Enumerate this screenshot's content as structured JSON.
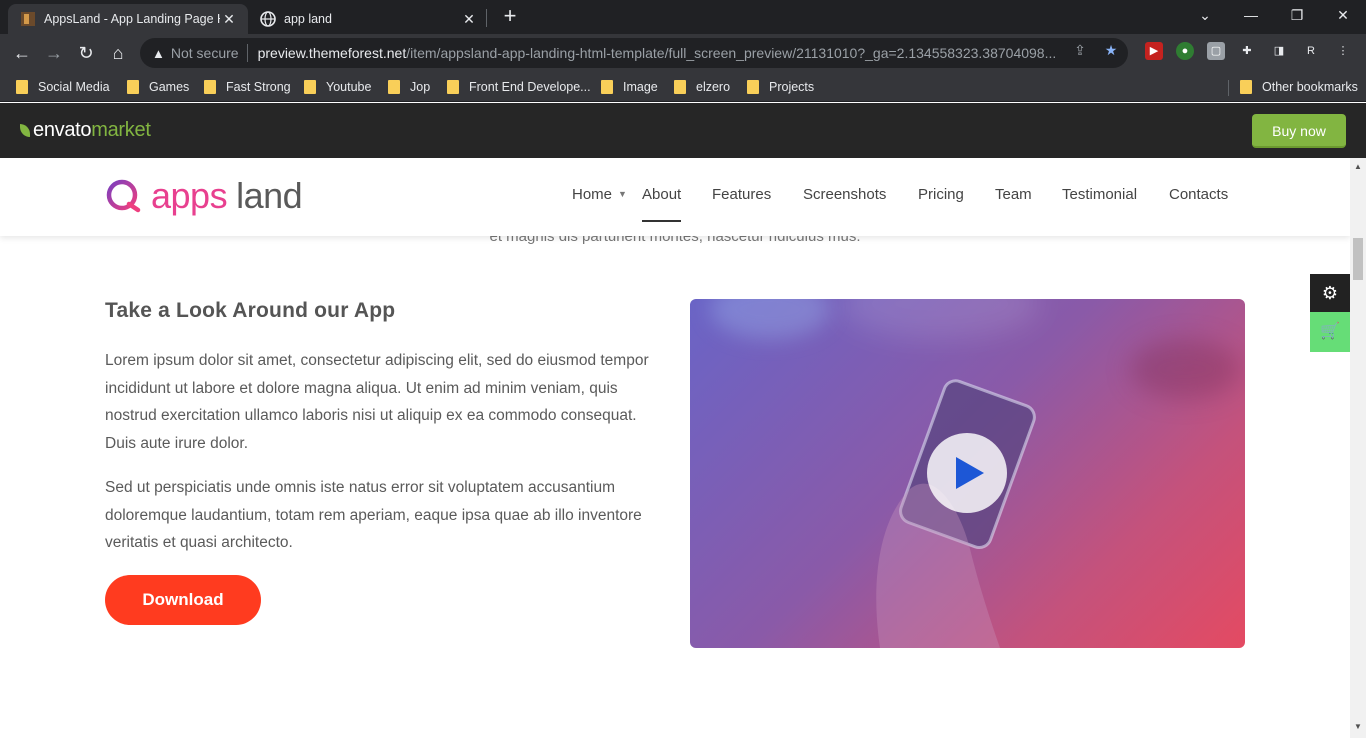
{
  "browser": {
    "tabs": [
      {
        "title": "AppsLand - App Landing Page HTML",
        "active": true
      },
      {
        "title": "app land",
        "active": false
      }
    ],
    "close_glyph": "✕",
    "new_tab_glyph": "+",
    "window_controls": {
      "dropdown": "⌄",
      "minimize": "—",
      "restore": "❐",
      "close": "✕"
    },
    "toolbar": {
      "back": "←",
      "forward": "→",
      "reload": "↻",
      "home": "⌂",
      "security_label": "Not secure",
      "url_host": "preview.themeforest.net",
      "url_path": "/item/appsland-app-landing-html-template/full_screen_preview/21131010?_ga=2.134558323.38704098...",
      "profile_initial": "R"
    },
    "bookmarks": [
      "Social Media",
      "Games",
      "Fast Strong",
      "Youtube",
      "Jop",
      "Front End Develope...",
      "Image",
      "elzero",
      "Projects"
    ],
    "other_bookmarks": "Other bookmarks"
  },
  "envato": {
    "logo_envato": "envato",
    "logo_market": "market",
    "buy_now": "Buy now"
  },
  "site": {
    "brand_apps": "apps",
    "brand_land": "land",
    "nav": [
      "Home",
      "About",
      "Features",
      "Screenshots",
      "Pricing",
      "Team",
      "Testimonial",
      "Contacts"
    ],
    "active_nav": "About",
    "faded_text": "et magnis dis parturient montes, nascetur ridiculus mus.",
    "section_title": "Take a Look Around our App",
    "paragraph_1": "Lorem ipsum dolor sit amet, consectetur adipiscing elit, sed do eiusmod tempor incididunt ut labore et dolore magna aliqua. Ut enim ad minim veniam, quis nostrud exercitation ullamco laboris nisi ut aliquip ex ea commodo consequat. Duis aute irure dolor.",
    "paragraph_2": "Sed ut perspiciatis unde omnis iste natus error sit voluptatem accusantium doloremque laudantium, totam rem aperiam, eaque ipsa quae ab illo inventore veritatis et quasi architecto.",
    "download_label": "Download",
    "settings_glyph": "⚙",
    "cart_glyph": "🛒"
  },
  "colors": {
    "accent_pink": "#e8408f",
    "download_red": "#ff3b1f",
    "envato_green": "#82b541",
    "play_blue": "#1d57d6"
  }
}
